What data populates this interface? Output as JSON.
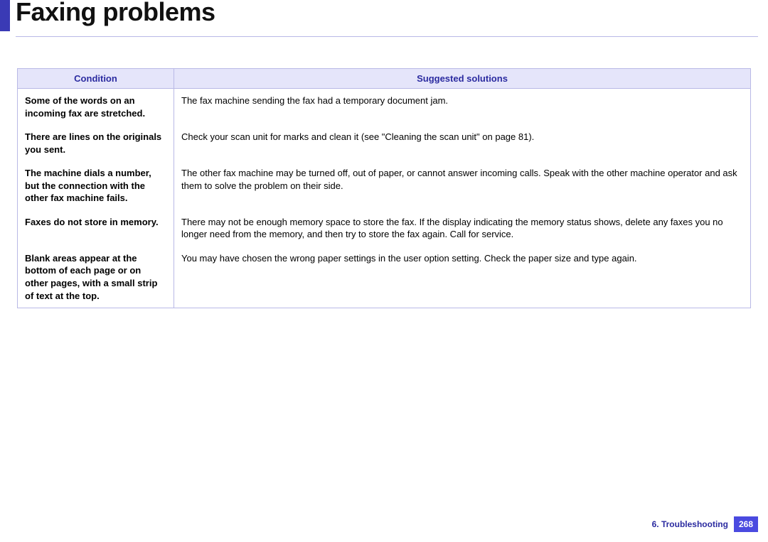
{
  "title": "Faxing problems",
  "table": {
    "headers": {
      "condition": "Condition",
      "solutions": "Suggested solutions"
    },
    "rows": [
      {
        "condition": "Some of the words on an incoming fax are stretched.",
        "solution": "The fax machine sending the fax had a temporary document jam."
      },
      {
        "condition": "There are lines on the originals you sent.",
        "solution": "Check your scan unit for marks and clean it (see \"Cleaning the scan unit\" on page 81)."
      },
      {
        "condition": "The machine dials a number, but the connection with the other fax machine fails.",
        "solution": "The other fax machine may be turned off, out of paper, or cannot answer incoming calls. Speak with the other machine operator and ask them to solve the problem on their side."
      },
      {
        "condition": "Faxes do not store in memory.",
        "solution": "There may not be enough memory space to store the fax. If the display indicating the memory status shows, delete any faxes you no longer need from the memory, and then try to store the fax again. Call for service."
      },
      {
        "condition": "Blank areas appear at the bottom of each page or on other pages, with a small strip of text at the top.",
        "solution": "You may have chosen the wrong paper settings in the user option setting. Check the paper size and type again."
      }
    ]
  },
  "footer": {
    "chapter": "6.  Troubleshooting",
    "page": "268"
  }
}
